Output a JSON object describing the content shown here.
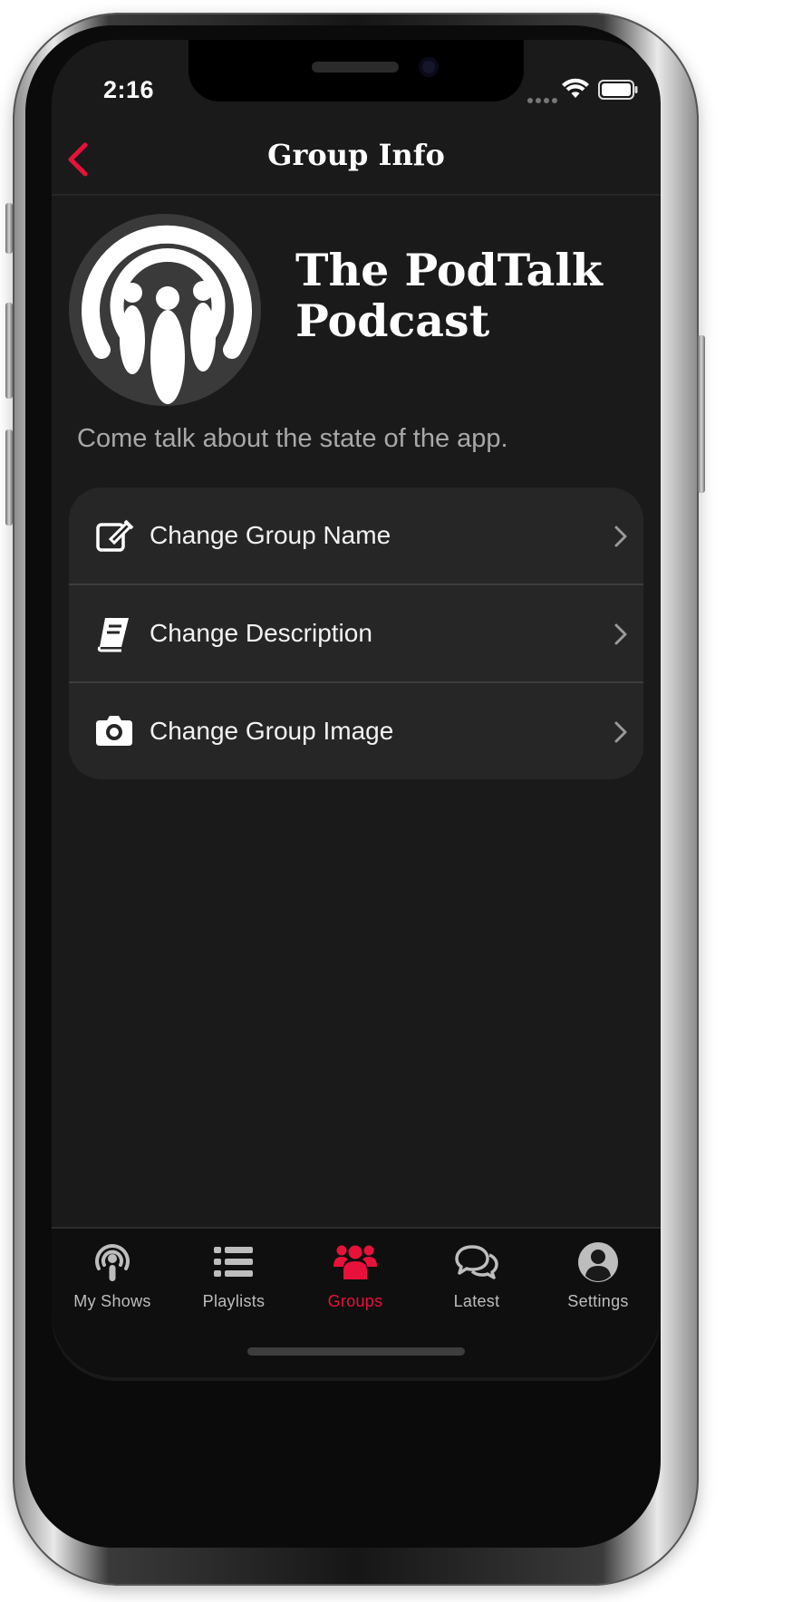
{
  "status_bar": {
    "time": "2:16"
  },
  "nav": {
    "title": "Group Info"
  },
  "group": {
    "name": "The PodTalk Podcast",
    "description": "Come talk about the state of the app."
  },
  "options": [
    {
      "label": "Change Group Name",
      "icon": "edit-icon"
    },
    {
      "label": "Change Description",
      "icon": "book-icon"
    },
    {
      "label": "Change Group Image",
      "icon": "camera-icon"
    }
  ],
  "tabs": [
    {
      "label": "My Shows",
      "icon": "podcast-icon",
      "active": false
    },
    {
      "label": "Playlists",
      "icon": "list-icon",
      "active": false
    },
    {
      "label": "Groups",
      "icon": "users-icon",
      "active": true
    },
    {
      "label": "Latest",
      "icon": "chat-icon",
      "active": false
    },
    {
      "label": "Settings",
      "icon": "user-circle-icon",
      "active": false
    }
  ],
  "colors": {
    "accent": "#e8113b",
    "background": "#1a1a1a",
    "card": "#262626"
  }
}
